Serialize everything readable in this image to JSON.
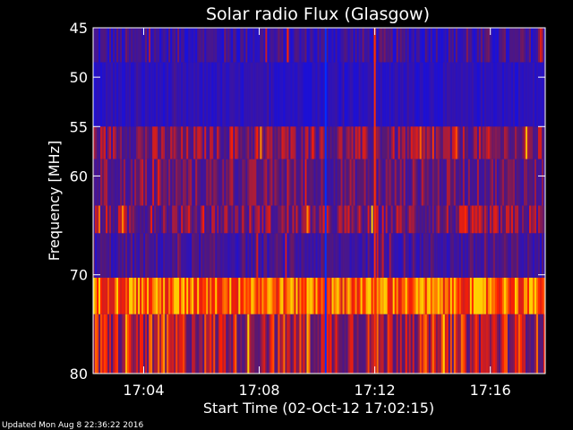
{
  "chart_data": {
    "type": "heatmap",
    "title": "Solar radio Flux (Glasgow)",
    "xlabel": "Start Time (02-Oct-12 17:02:15)",
    "ylabel": "Frequency [MHz]",
    "footer": "Updated Mon Aug  8 22:36:22 2016",
    "x_start_minutes": 1022.25,
    "x_end_minutes": 1037.9,
    "x_ticks": [
      {
        "label": "17:04",
        "minutes": 1024
      },
      {
        "label": "17:08",
        "minutes": 1028
      },
      {
        "label": "17:12",
        "minutes": 1032
      },
      {
        "label": "17:16",
        "minutes": 1036
      }
    ],
    "y_ticks": [
      45,
      50,
      55,
      60,
      70,
      80
    ],
    "ylim": [
      45,
      80
    ],
    "y_inverted": true,
    "grid": false,
    "colors": {
      "low": "#1a10d8",
      "mid": "#5a1870",
      "high": "#ff2000",
      "peak": "#ffd000",
      "text": "#ffffff",
      "background": "#000000"
    },
    "bands": [
      {
        "f_low": 45.0,
        "f_high": 48.5,
        "mean_intensity": 0.22,
        "variability": 0.3
      },
      {
        "f_low": 48.5,
        "f_high": 55.0,
        "mean_intensity": 0.12,
        "variability": 0.12
      },
      {
        "f_low": 55.0,
        "f_high": 58.3,
        "mean_intensity": 0.48,
        "variability": 0.25
      },
      {
        "f_low": 58.3,
        "f_high": 63.0,
        "mean_intensity": 0.42,
        "variability": 0.22
      },
      {
        "f_low": 63.0,
        "f_high": 65.8,
        "mean_intensity": 0.47,
        "variability": 0.28
      },
      {
        "f_low": 65.8,
        "f_high": 70.3,
        "mean_intensity": 0.28,
        "variability": 0.22
      },
      {
        "f_low": 70.3,
        "f_high": 74.0,
        "mean_intensity": 0.88,
        "variability": 0.18
      },
      {
        "f_low": 74.0,
        "f_high": 80.0,
        "mean_intensity": 0.62,
        "variability": 0.28
      }
    ],
    "features": [
      {
        "type": "vertical_line",
        "time_minutes": 1030.3,
        "color": "#0030ff"
      },
      {
        "type": "vertical_line",
        "time_minutes": 1032.0,
        "color": "#ff3000"
      }
    ]
  }
}
